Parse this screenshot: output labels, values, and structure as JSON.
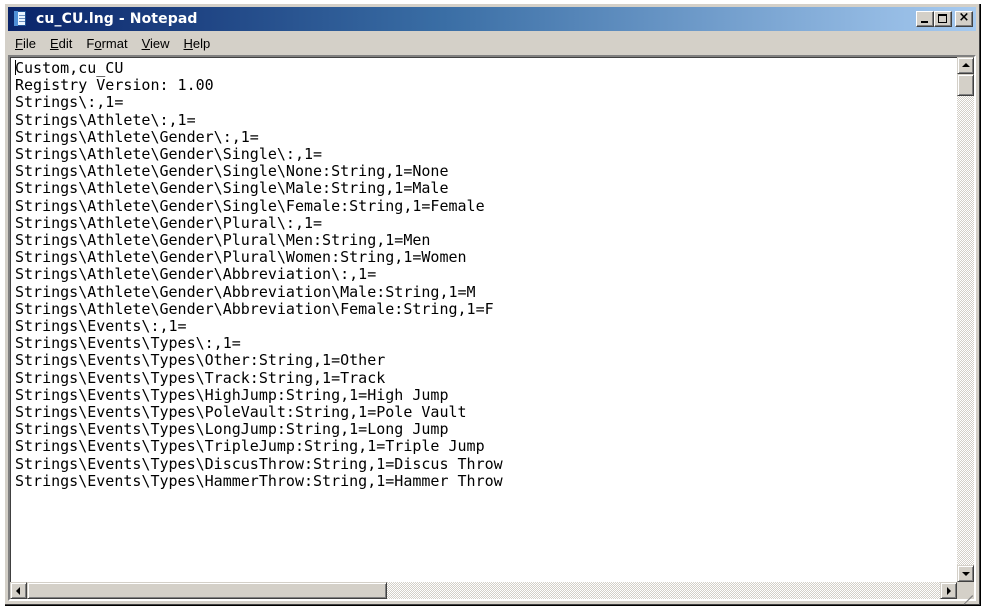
{
  "window": {
    "title": "cu_CU.lng - Notepad"
  },
  "menu": {
    "file": "File",
    "edit": "Edit",
    "format": "Format",
    "view": "View",
    "help": "Help"
  },
  "document": {
    "lines": [
      "Custom,cu_CU",
      "Registry Version: 1.00",
      "Strings\\:,1=",
      "Strings\\Athlete\\:,1=",
      "Strings\\Athlete\\Gender\\:,1=",
      "Strings\\Athlete\\Gender\\Single\\:,1=",
      "Strings\\Athlete\\Gender\\Single\\None:String,1=None",
      "Strings\\Athlete\\Gender\\Single\\Male:String,1=Male",
      "Strings\\Athlete\\Gender\\Single\\Female:String,1=Female",
      "Strings\\Athlete\\Gender\\Plural\\:,1=",
      "Strings\\Athlete\\Gender\\Plural\\Men:String,1=Men",
      "Strings\\Athlete\\Gender\\Plural\\Women:String,1=Women",
      "Strings\\Athlete\\Gender\\Abbreviation\\:,1=",
      "Strings\\Athlete\\Gender\\Abbreviation\\Male:String,1=M",
      "Strings\\Athlete\\Gender\\Abbreviation\\Female:String,1=F",
      "Strings\\Events\\:,1=",
      "Strings\\Events\\Types\\:,1=",
      "Strings\\Events\\Types\\Other:String,1=Other",
      "Strings\\Events\\Types\\Track:String,1=Track",
      "Strings\\Events\\Types\\HighJump:String,1=High Jump",
      "Strings\\Events\\Types\\PoleVault:String,1=Pole Vault",
      "Strings\\Events\\Types\\LongJump:String,1=Long Jump",
      "Strings\\Events\\Types\\TripleJump:String,1=Triple Jump",
      "Strings\\Events\\Types\\DiscusThrow:String,1=Discus Throw",
      "Strings\\Events\\Types\\HammerThrow:String,1=Hammer Throw"
    ]
  },
  "icons": {
    "app": "notepad-icon",
    "minimize": "minimize-icon",
    "maximize": "maximize-icon",
    "close": "close-icon"
  },
  "colors": {
    "titlebar_start": "#0a246a",
    "titlebar_end": "#a6caf0",
    "chrome": "#d4d0c8"
  }
}
